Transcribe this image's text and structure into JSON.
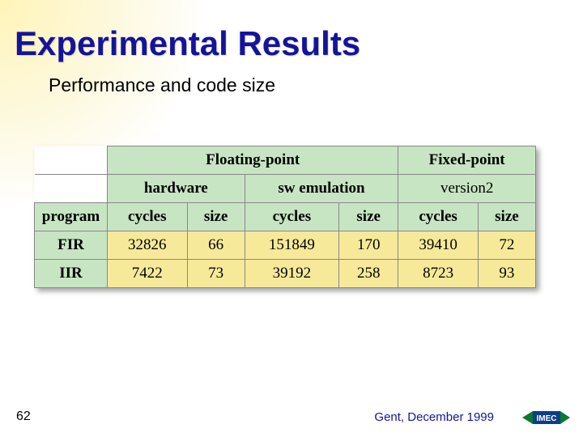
{
  "title": "Experimental Results",
  "subtitle": "Performance and code size",
  "table": {
    "group_headers": {
      "floating": "Floating-point",
      "fixed": "Fixed-point"
    },
    "sub_headers": {
      "hardware": "hardware",
      "sw_emulation": "sw emulation",
      "version2": "version2"
    },
    "col_labels": {
      "program": "program",
      "cycles": "cycles",
      "size": "size"
    },
    "rows": [
      {
        "label": "FIR",
        "hw_cycles": "32826",
        "hw_size": "66",
        "sw_cycles": "151849",
        "sw_size": "170",
        "fx_cycles": "39410",
        "fx_size": "72"
      },
      {
        "label": "IIR",
        "hw_cycles": "7422",
        "hw_size": "73",
        "sw_cycles": "39192",
        "sw_size": "258",
        "fx_cycles": "8723",
        "fx_size": "93"
      }
    ]
  },
  "footer": {
    "slide_number": "62",
    "location_date": "Gent, December 1999",
    "logo_text": "IMEC"
  },
  "chart_data": {
    "type": "table",
    "title": "Performance and code size",
    "columns": [
      "program",
      "floating_hw_cycles",
      "floating_hw_size",
      "floating_sw_cycles",
      "floating_sw_size",
      "fixed_v2_cycles",
      "fixed_v2_size"
    ],
    "rows": [
      [
        "FIR",
        32826,
        66,
        151849,
        170,
        39410,
        72
      ],
      [
        "IIR",
        7422,
        73,
        39192,
        258,
        8723,
        93
      ]
    ]
  }
}
